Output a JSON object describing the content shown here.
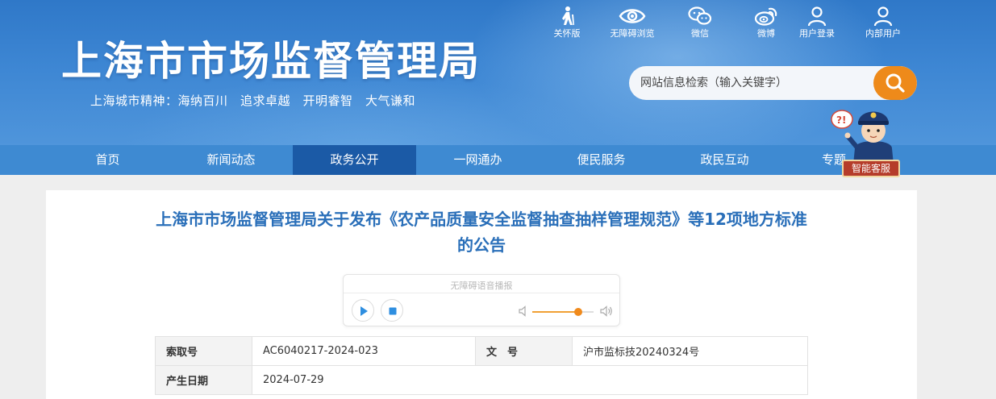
{
  "header": {
    "site_title": "上海市市场监督管理局",
    "slogan": "上海城市精神：海纳百川　追求卓越　开明睿智　大气谦和",
    "top_links": [
      {
        "label": "关怀版",
        "icon": "elderly-icon"
      },
      {
        "label": "无障碍浏览",
        "icon": "eye-icon"
      },
      {
        "label": "微信",
        "icon": "wechat-icon"
      },
      {
        "label": "微博",
        "icon": "weibo-icon"
      },
      {
        "label": "用户登录",
        "icon": "user-icon"
      },
      {
        "label": "内部用户",
        "icon": "user-icon"
      }
    ],
    "search": {
      "placeholder": "网站信息检索（输入关键字）",
      "value": ""
    },
    "assistant": {
      "label": "智能客服",
      "icon": "police-mascot-icon"
    }
  },
  "nav": {
    "items": [
      "首页",
      "新闻动态",
      "政务公开",
      "一网通办",
      "便民服务",
      "政民互动",
      "专题"
    ],
    "active": "政务公开"
  },
  "article": {
    "title": "上海市市场监督管理局关于发布《农产品质量安全监督抽查抽样管理规范》等12项地方标准的公告",
    "audio": {
      "label": "无障碍语音播报",
      "volume": 0.75
    },
    "info": {
      "index_key": "索取号",
      "index_value": "AC6040217-2024-023",
      "doc_key": "文　号",
      "doc_value": "沪市监标技20240324号",
      "date_key": "产生日期",
      "date_value": "2024-07-29"
    }
  },
  "colors": {
    "header_blue": "#3d86d3",
    "nav_blue": "#3e8ad2",
    "nav_active": "#1b5aa6",
    "title_blue": "#2a6fb9",
    "search_orange": "#ee8a1a"
  }
}
